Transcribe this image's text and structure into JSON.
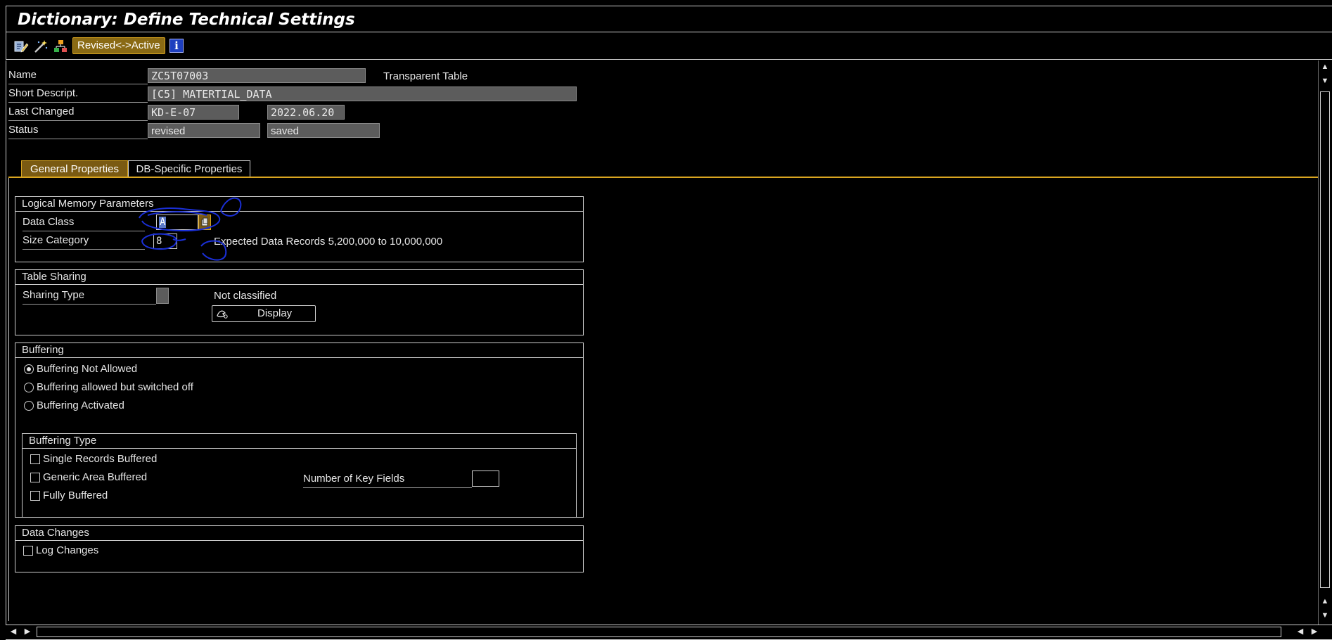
{
  "window": {
    "title": "Dictionary: Define Technical Settings"
  },
  "toolbar": {
    "icons": [
      "display-change-icon",
      "magic-wand-icon",
      "hierarchy-icon"
    ],
    "revised_active_label": "Revised<->Active",
    "info_label": "i"
  },
  "header": {
    "name_label": "Name",
    "name_value": "ZC5T07003",
    "table_type": "Transparent Table",
    "short_desc_label": "Short Descript.",
    "short_desc_value": "[C5] MATERTIAL_DATA",
    "last_changed_label": "Last Changed",
    "last_changed_user": "KD-E-07",
    "last_changed_date": "2022.06.20",
    "status_label": "Status",
    "status_value": "revised",
    "status_saved": "saved"
  },
  "tabs": [
    {
      "label": "General Properties",
      "active": true
    },
    {
      "label": "DB-Specific Properties",
      "active": false
    }
  ],
  "logical_memory": {
    "title": "Logical Memory Parameters",
    "data_class_label": "Data Class",
    "data_class_value": "A",
    "size_category_label": "Size Category",
    "size_category_value": "8",
    "expected_records": "Expected Data Records 5,200,000 to 10,000,000"
  },
  "table_sharing": {
    "title": "Table Sharing",
    "sharing_type_label": "Sharing Type",
    "sharing_type_value": "",
    "classification": "Not classified",
    "display_button": "Display"
  },
  "buffering": {
    "title": "Buffering",
    "options": [
      {
        "label": "Buffering Not Allowed",
        "selected": true
      },
      {
        "label": "Buffering allowed but switched off",
        "selected": false
      },
      {
        "label": "Buffering Activated",
        "selected": false
      }
    ],
    "type_title": "Buffering Type",
    "types": [
      {
        "label": "Single Records Buffered",
        "checked": false
      },
      {
        "label": "Generic Area Buffered",
        "checked": false
      },
      {
        "label": "Fully Buffered",
        "checked": false
      }
    ],
    "key_fields_label": "Number of Key Fields",
    "key_fields_value": ""
  },
  "data_changes": {
    "title": "Data Changes",
    "log_changes_label": "Log Changes",
    "log_changes_checked": false
  },
  "colors": {
    "accent": "#d9a520",
    "tab_active": "#7a5a12",
    "field_bg": "#5c5c5c",
    "annotation": "#1a2fd6"
  }
}
